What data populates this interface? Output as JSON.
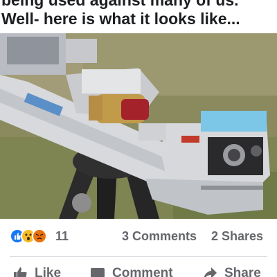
{
  "post": {
    "text_line1": "being used against many of us.",
    "text_line2": "Well- here is what it looks like..."
  },
  "reactions": {
    "icons": [
      "like-icon",
      "wow-icon",
      "angry-icon"
    ],
    "count": "11",
    "comments": "3 Comments",
    "shares": "2 Shares"
  },
  "actions": {
    "like_label": "Like",
    "comment_label": "Comment",
    "share_label": "Share"
  },
  "colors": {
    "like_blue": "#1877f2",
    "wow_yellow": "#f7b928",
    "angry_orange": "#e9710f",
    "secondary_text": "#65676b"
  }
}
